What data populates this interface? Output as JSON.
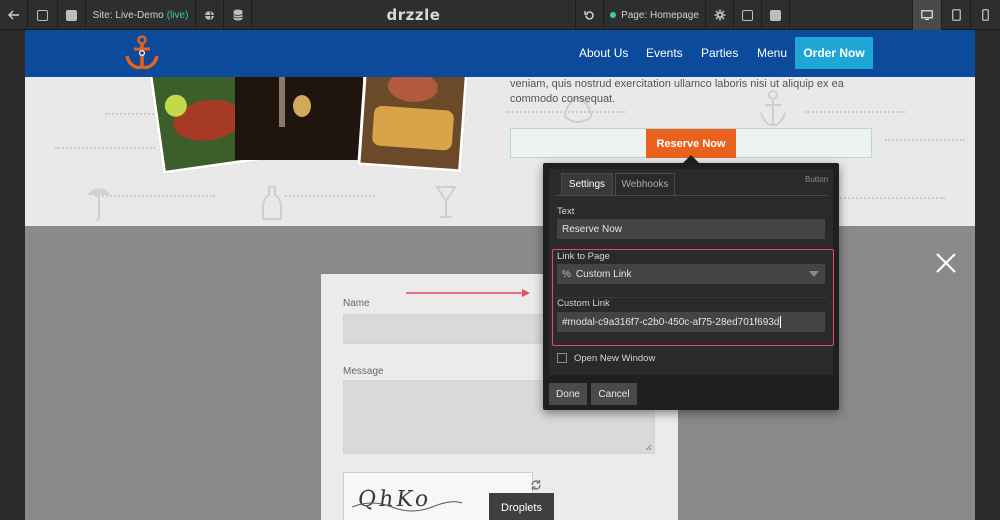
{
  "toolbar": {
    "site_label": "Site: Live-Demo",
    "site_status": "(live)",
    "brand": "drzzle",
    "page_label": "Page: Homepage",
    "icons": [
      "back-arrow-icon",
      "pages-icon",
      "add-page-icon",
      "globe-icon",
      "database-icon",
      "undo-icon",
      "gear-icon",
      "save-icon",
      "preview-icon",
      "desktop-icon",
      "tablet-icon",
      "mobile-icon"
    ]
  },
  "site": {
    "nav": {
      "items": [
        "About Us",
        "Events",
        "Parties",
        "Menu"
      ],
      "order_button": "Order Now"
    },
    "hero": {
      "body_line1": "veniam, quis nostrud exercitation ullamco laboris nisi ut aliquip ex ea",
      "body_line2": "commodo consequat.",
      "reserve_button": "Reserve Now"
    },
    "form": {
      "name_label": "Name",
      "message_label": "Message",
      "captcha_text": "QhKo",
      "droplets_button": "Droplets"
    },
    "colors": {
      "nav": "#0c4a9c",
      "order_button": "#1ea7d6",
      "reserve_button": "#e8621d",
      "highlight": "#e0505a"
    }
  },
  "popover": {
    "tabs": [
      "Settings",
      "Webhooks"
    ],
    "active_tab": "Settings",
    "type_label": "Button",
    "text_label": "Text",
    "text_value": "Reserve Now",
    "link_label": "Link to Page",
    "link_value": "Custom Link",
    "custom_link_label": "Custom Link",
    "custom_link_value": "#modal-c9a316f7-c2b0-450c-af75-28ed701f693d",
    "new_window_label": "Open New Window",
    "done_button": "Done",
    "cancel_button": "Cancel"
  }
}
